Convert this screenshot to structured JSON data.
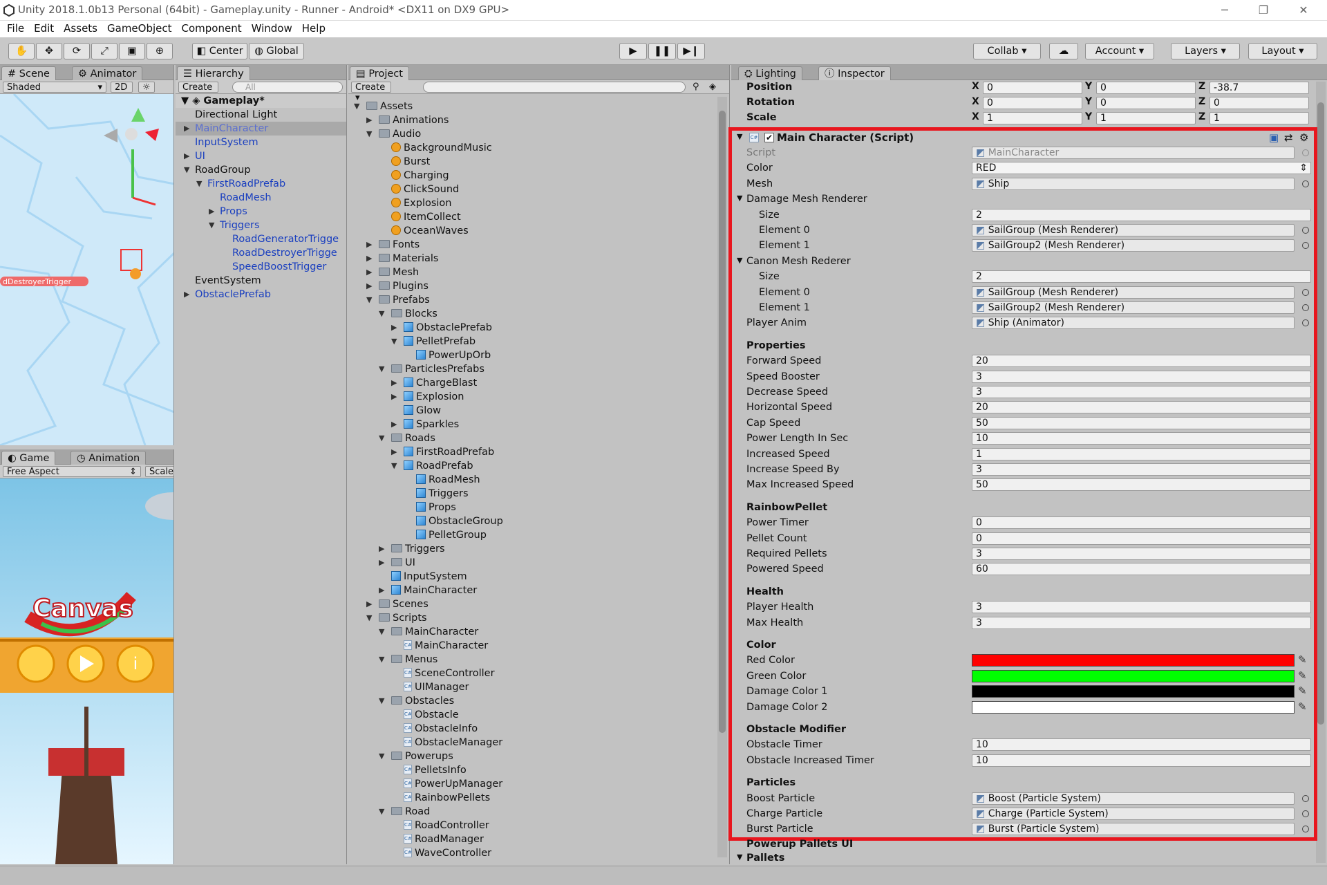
{
  "window": {
    "title": "Unity 2018.1.0b13 Personal (64bit) - Gameplay.unity - Runner - Android* <DX11 on DX9 GPU>"
  },
  "menu": [
    "File",
    "Edit",
    "Assets",
    "GameObject",
    "Component",
    "Window",
    "Help"
  ],
  "toolbar": {
    "center": "Center",
    "global": "Global",
    "collab": "Collab",
    "account": "Account",
    "layers": "Layers",
    "layout": "Layout"
  },
  "scene": {
    "tab": "Scene",
    "tab2": "Animator",
    "shading": "Shaded",
    "mode2d": "2D",
    "trigger_label": "dDestroyerTrigger"
  },
  "game": {
    "tab": "Game",
    "tab2": "Animation",
    "aspect": "Free Aspect",
    "scale": "Scale",
    "logo": "Canvas"
  },
  "hierarchy": {
    "tab": "Hierarchy",
    "create": "Create",
    "search": "All",
    "scene_name": "Gameplay*",
    "items": [
      {
        "label": "Directional Light",
        "indent": 0,
        "arrow": "",
        "blue": false
      },
      {
        "label": "MainCharacter",
        "indent": 0,
        "arrow": "right",
        "blue": true,
        "selected": true
      },
      {
        "label": "InputSystem",
        "indent": 0,
        "arrow": "",
        "blue": true
      },
      {
        "label": "UI",
        "indent": 0,
        "arrow": "right",
        "blue": true
      },
      {
        "label": "RoadGroup",
        "indent": 0,
        "arrow": "down",
        "blue": false
      },
      {
        "label": "FirstRoadPrefab",
        "indent": 1,
        "arrow": "down",
        "blue": true
      },
      {
        "label": "RoadMesh",
        "indent": 2,
        "arrow": "",
        "blue": true
      },
      {
        "label": "Props",
        "indent": 2,
        "arrow": "right",
        "blue": true
      },
      {
        "label": "Triggers",
        "indent": 2,
        "arrow": "down",
        "blue": true
      },
      {
        "label": "RoadGeneratorTrigge",
        "indent": 3,
        "arrow": "",
        "blue": true
      },
      {
        "label": "RoadDestroyerTrigge",
        "indent": 3,
        "arrow": "",
        "blue": true
      },
      {
        "label": "SpeedBoostTrigger",
        "indent": 3,
        "arrow": "",
        "blue": true
      },
      {
        "label": "EventSystem",
        "indent": 0,
        "arrow": "",
        "blue": false
      },
      {
        "label": "ObstaclePrefab",
        "indent": 0,
        "arrow": "right",
        "blue": true
      }
    ]
  },
  "project": {
    "tab": "Project",
    "create": "Create",
    "items": [
      {
        "label": "Assets",
        "indent": 0,
        "arrow": "down",
        "icon": "folder"
      },
      {
        "label": "Animations",
        "indent": 1,
        "arrow": "right",
        "icon": "folder"
      },
      {
        "label": "Audio",
        "indent": 1,
        "arrow": "down",
        "icon": "folder"
      },
      {
        "label": "BackgroundMusic",
        "indent": 2,
        "arrow": "",
        "icon": "audio"
      },
      {
        "label": "Burst",
        "indent": 2,
        "arrow": "",
        "icon": "audio"
      },
      {
        "label": "Charging",
        "indent": 2,
        "arrow": "",
        "icon": "audio"
      },
      {
        "label": "ClickSound",
        "indent": 2,
        "arrow": "",
        "icon": "audio"
      },
      {
        "label": "Explosion",
        "indent": 2,
        "arrow": "",
        "icon": "audio"
      },
      {
        "label": "ItemCollect",
        "indent": 2,
        "arrow": "",
        "icon": "audio"
      },
      {
        "label": "OceanWaves",
        "indent": 2,
        "arrow": "",
        "icon": "audio"
      },
      {
        "label": "Fonts",
        "indent": 1,
        "arrow": "right",
        "icon": "folder"
      },
      {
        "label": "Materials",
        "indent": 1,
        "arrow": "right",
        "icon": "folder"
      },
      {
        "label": "Mesh",
        "indent": 1,
        "arrow": "right",
        "icon": "folder"
      },
      {
        "label": "Plugins",
        "indent": 1,
        "arrow": "right",
        "icon": "folder"
      },
      {
        "label": "Prefabs",
        "indent": 1,
        "arrow": "down",
        "icon": "folder"
      },
      {
        "label": "Blocks",
        "indent": 2,
        "arrow": "down",
        "icon": "folder"
      },
      {
        "label": "ObstaclePrefab",
        "indent": 3,
        "arrow": "right",
        "icon": "cube"
      },
      {
        "label": "PelletPrefab",
        "indent": 3,
        "arrow": "down",
        "icon": "cube"
      },
      {
        "label": "PowerUpOrb",
        "indent": 4,
        "arrow": "",
        "icon": "cube"
      },
      {
        "label": "ParticlesPrefabs",
        "indent": 2,
        "arrow": "down",
        "icon": "folder"
      },
      {
        "label": "ChargeBlast",
        "indent": 3,
        "arrow": "right",
        "icon": "cube"
      },
      {
        "label": "Explosion",
        "indent": 3,
        "arrow": "right",
        "icon": "cube"
      },
      {
        "label": "Glow",
        "indent": 3,
        "arrow": "",
        "icon": "cube"
      },
      {
        "label": "Sparkles",
        "indent": 3,
        "arrow": "right",
        "icon": "cube"
      },
      {
        "label": "Roads",
        "indent": 2,
        "arrow": "down",
        "icon": "folder"
      },
      {
        "label": "FirstRoadPrefab",
        "indent": 3,
        "arrow": "right",
        "icon": "cube"
      },
      {
        "label": "RoadPrefab",
        "indent": 3,
        "arrow": "down",
        "icon": "cube"
      },
      {
        "label": "RoadMesh",
        "indent": 4,
        "arrow": "",
        "icon": "cube"
      },
      {
        "label": "Triggers",
        "indent": 4,
        "arrow": "",
        "icon": "cube"
      },
      {
        "label": "Props",
        "indent": 4,
        "arrow": "",
        "icon": "cube"
      },
      {
        "label": "ObstacleGroup",
        "indent": 4,
        "arrow": "",
        "icon": "cube"
      },
      {
        "label": "PelletGroup",
        "indent": 4,
        "arrow": "",
        "icon": "cube"
      },
      {
        "label": "Triggers",
        "indent": 2,
        "arrow": "right",
        "icon": "folder"
      },
      {
        "label": "UI",
        "indent": 2,
        "arrow": "right",
        "icon": "folder"
      },
      {
        "label": "InputSystem",
        "indent": 2,
        "arrow": "",
        "icon": "cube"
      },
      {
        "label": "MainCharacter",
        "indent": 2,
        "arrow": "right",
        "icon": "cube"
      },
      {
        "label": "Scenes",
        "indent": 1,
        "arrow": "right",
        "icon": "folder"
      },
      {
        "label": "Scripts",
        "indent": 1,
        "arrow": "down",
        "icon": "folder"
      },
      {
        "label": "MainCharacter",
        "indent": 2,
        "arrow": "down",
        "icon": "folder"
      },
      {
        "label": "MainCharacter",
        "indent": 3,
        "arrow": "",
        "icon": "script"
      },
      {
        "label": "Menus",
        "indent": 2,
        "arrow": "down",
        "icon": "folder"
      },
      {
        "label": "SceneController",
        "indent": 3,
        "arrow": "",
        "icon": "script"
      },
      {
        "label": "UIManager",
        "indent": 3,
        "arrow": "",
        "icon": "script"
      },
      {
        "label": "Obstacles",
        "indent": 2,
        "arrow": "down",
        "icon": "folder"
      },
      {
        "label": "Obstacle",
        "indent": 3,
        "arrow": "",
        "icon": "script"
      },
      {
        "label": "ObstacleInfo",
        "indent": 3,
        "arrow": "",
        "icon": "script"
      },
      {
        "label": "ObstacleManager",
        "indent": 3,
        "arrow": "",
        "icon": "script"
      },
      {
        "label": "Powerups",
        "indent": 2,
        "arrow": "down",
        "icon": "folder"
      },
      {
        "label": "PelletsInfo",
        "indent": 3,
        "arrow": "",
        "icon": "script"
      },
      {
        "label": "PowerUpManager",
        "indent": 3,
        "arrow": "",
        "icon": "script"
      },
      {
        "label": "RainbowPellets",
        "indent": 3,
        "arrow": "",
        "icon": "script"
      },
      {
        "label": "Road",
        "indent": 2,
        "arrow": "down",
        "icon": "folder"
      },
      {
        "label": "RoadController",
        "indent": 3,
        "arrow": "",
        "icon": "script"
      },
      {
        "label": "RoadManager",
        "indent": 3,
        "arrow": "",
        "icon": "script"
      },
      {
        "label": "WaveController",
        "indent": 3,
        "arrow": "",
        "icon": "script"
      }
    ]
  },
  "inspector": {
    "tab_lighting": "Lighting",
    "tab_inspector": "Inspector",
    "transform": [
      {
        "label": "Position",
        "x": "0",
        "y": "0",
        "z": "-38.7"
      },
      {
        "label": "Rotation",
        "x": "0",
        "y": "0",
        "z": "0"
      },
      {
        "label": "Scale",
        "x": "1",
        "y": "1",
        "z": "1"
      }
    ],
    "component_title": "Main Character (Script)",
    "rows": [
      {
        "kind": "prop",
        "label": "Script",
        "value": "MainCharacter",
        "obj": true,
        "dim": true
      },
      {
        "kind": "enum",
        "label": "Color",
        "value": "RED"
      },
      {
        "kind": "prop",
        "label": "Mesh",
        "value": "Ship",
        "obj": true
      },
      {
        "kind": "fold",
        "label": "Damage Mesh Renderer"
      },
      {
        "kind": "prop",
        "label": "Size",
        "value": "2",
        "indent": 1
      },
      {
        "kind": "prop",
        "label": "Element 0",
        "value": "SailGroup (Mesh Renderer)",
        "obj": true,
        "indent": 1
      },
      {
        "kind": "prop",
        "label": "Element 1",
        "value": "SailGroup2 (Mesh Renderer)",
        "obj": true,
        "indent": 1
      },
      {
        "kind": "fold",
        "label": "Canon Mesh Rederer"
      },
      {
        "kind": "prop",
        "label": "Size",
        "value": "2",
        "indent": 1
      },
      {
        "kind": "prop",
        "label": "Element 0",
        "value": "SailGroup (Mesh Renderer)",
        "obj": true,
        "indent": 1
      },
      {
        "kind": "prop",
        "label": "Element 1",
        "value": "SailGroup2 (Mesh Renderer)",
        "obj": true,
        "indent": 1
      },
      {
        "kind": "prop",
        "label": "Player Anim",
        "value": "Ship (Animator)",
        "obj": true
      },
      {
        "kind": "header",
        "label": "Properties"
      },
      {
        "kind": "prop",
        "label": "Forward Speed",
        "value": "20"
      },
      {
        "kind": "prop",
        "label": "Speed Booster",
        "value": "3"
      },
      {
        "kind": "prop",
        "label": "Decrease Speed",
        "value": "3"
      },
      {
        "kind": "prop",
        "label": "Horizontal Speed",
        "value": "20"
      },
      {
        "kind": "prop",
        "label": "Cap Speed",
        "value": "50"
      },
      {
        "kind": "prop",
        "label": "Power Length In Sec",
        "value": "10"
      },
      {
        "kind": "prop",
        "label": "Increased Speed",
        "value": "1"
      },
      {
        "kind": "prop",
        "label": "Increase Speed By",
        "value": "3"
      },
      {
        "kind": "prop",
        "label": "Max Increased Speed",
        "value": "50"
      },
      {
        "kind": "header",
        "label": "RainbowPellet"
      },
      {
        "kind": "prop",
        "label": "Power Timer",
        "value": "0"
      },
      {
        "kind": "prop",
        "label": "Pellet Count",
        "value": "0"
      },
      {
        "kind": "prop",
        "label": "Required Pellets",
        "value": "3"
      },
      {
        "kind": "prop",
        "label": "Powered Speed",
        "value": "60"
      },
      {
        "kind": "header",
        "label": "Health"
      },
      {
        "kind": "prop",
        "label": "Player Health",
        "value": "3"
      },
      {
        "kind": "prop",
        "label": "Max Health",
        "value": "3"
      },
      {
        "kind": "header",
        "label": "Color"
      },
      {
        "kind": "color",
        "label": "Red Color",
        "value": "#ff0000"
      },
      {
        "kind": "color",
        "label": "Green Color",
        "value": "#00ff00"
      },
      {
        "kind": "color",
        "label": "Damage Color 1",
        "value": "#000000"
      },
      {
        "kind": "color",
        "label": "Damage Color 2",
        "value": "#ffffff"
      },
      {
        "kind": "header",
        "label": "Obstacle Modifier"
      },
      {
        "kind": "prop",
        "label": "Obstacle Timer",
        "value": "10"
      },
      {
        "kind": "prop",
        "label": "Obstacle Increased Timer",
        "value": "10"
      },
      {
        "kind": "header",
        "label": "Particles"
      },
      {
        "kind": "prop",
        "label": "Boost Particle",
        "value": "Boost (Particle System)",
        "obj": true
      },
      {
        "kind": "prop",
        "label": "Charge Particle",
        "value": "Charge (Particle System)",
        "obj": true
      },
      {
        "kind": "prop",
        "label": "Burst Particle",
        "value": "Burst (Particle System)",
        "obj": true
      }
    ],
    "after": [
      "Powerup Pallets UI",
      "Pallets"
    ]
  },
  "colors": {
    "highlight": "#e8161e",
    "link": "#1a3fbf"
  }
}
